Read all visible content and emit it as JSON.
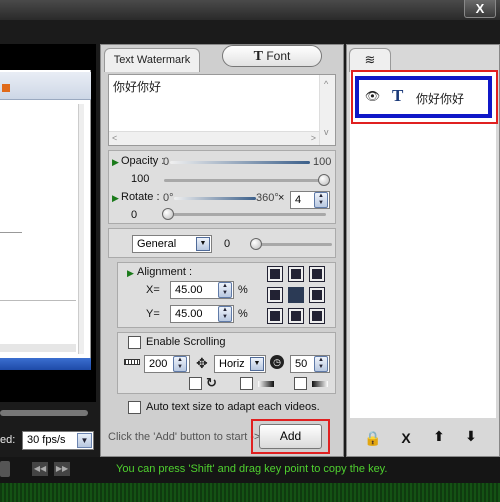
{
  "window": {
    "close_label": "X"
  },
  "player": {
    "speed_label": "ed:",
    "speed_value": "30 fps/s"
  },
  "tabs": {
    "watermark": "Text Watermark",
    "font_letter": "T",
    "font": "Font"
  },
  "text_input": {
    "value": "你好你好"
  },
  "opacity": {
    "label": "Opacity :",
    "min": "0",
    "max": "100",
    "value": "100"
  },
  "rotate": {
    "label": "Rotate :",
    "min": "0°",
    "max": "360°",
    "multiplier_symbol": "×",
    "multiplier_value": "4",
    "value": "0"
  },
  "blend": {
    "mode": "General",
    "value": "0"
  },
  "alignment": {
    "label": "Alignment :",
    "x_label": "X=",
    "x_value": "45.00",
    "y_label": "Y=",
    "y_value": "45.00",
    "unit": "%"
  },
  "scrolling": {
    "enable_label": "Enable Scrolling",
    "speed_value": "200",
    "direction": "Horiz",
    "duration_value": "50"
  },
  "auto_size": {
    "label": "Auto text size to adapt each videos."
  },
  "add_area": {
    "hint": "Click the 'Add' button to start ->",
    "button": "Add"
  },
  "layers": {
    "items": [
      {
        "type_letter": "T",
        "text": "你好你好"
      }
    ],
    "actions": {
      "delete": "X"
    }
  },
  "status": {
    "hint": "You can press 'Shift' and drag key point to copy the key."
  },
  "colors": {
    "status_text": "#4fd12f",
    "highlight_red": "#e02020",
    "selection_blue": "#1018c8"
  }
}
